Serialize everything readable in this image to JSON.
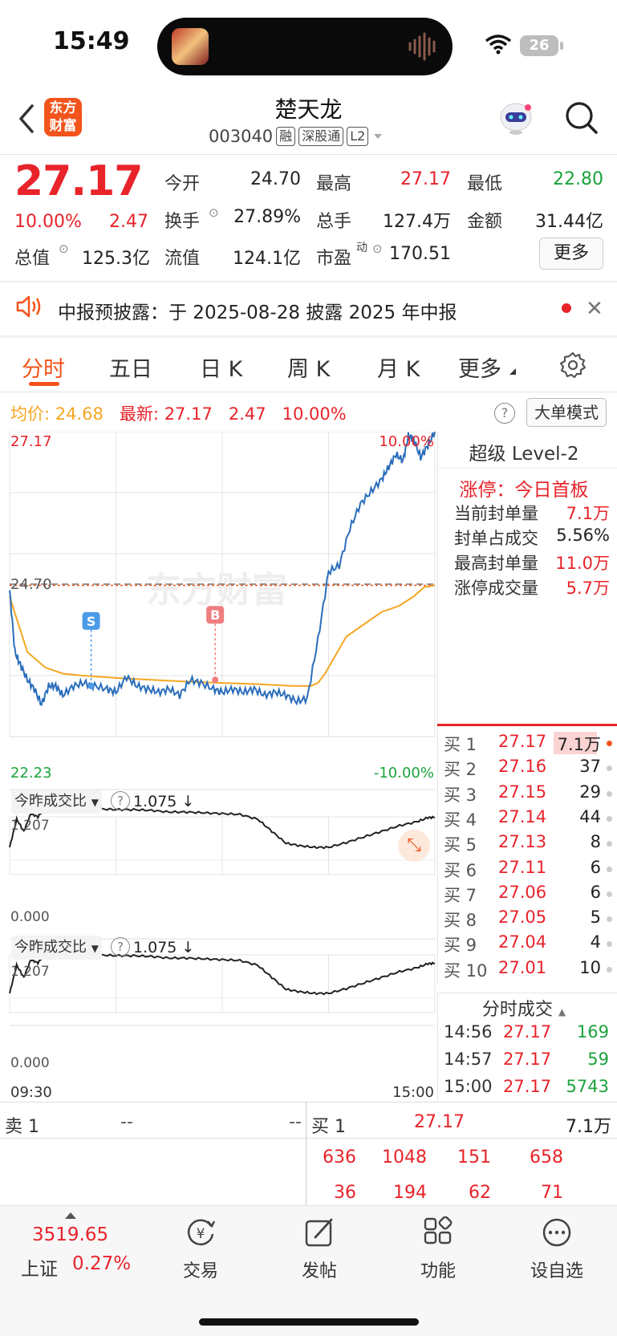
{
  "status_bar": {
    "time": "15:49",
    "battery": "26"
  },
  "header": {
    "brand": "东方财富",
    "name": "楚天龙",
    "code": "003040",
    "tags": [
      "融",
      "深股通",
      "L2"
    ]
  },
  "quote": {
    "price": "27.17",
    "change_pct": "10.00%",
    "change_amt": "2.47",
    "fields": [
      {
        "label": "今开",
        "value": "24.70",
        "color": "#222222"
      },
      {
        "label": "最高",
        "value": "27.17",
        "color": "#e8232a"
      },
      {
        "label": "最低",
        "value": "22.80",
        "color": "#1aa33c"
      },
      {
        "label": "换手",
        "value": "27.89%",
        "color": "#222222"
      },
      {
        "label": "总手",
        "value": "127.4万",
        "color": "#222222"
      },
      {
        "label": "金额",
        "value": "31.44亿",
        "color": "#222222"
      },
      {
        "label": "总值",
        "value": "125.3亿",
        "color": "#222222"
      },
      {
        "label": "流值",
        "value": "124.1亿",
        "color": "#222222"
      },
      {
        "label": "市盈",
        "superscript": "动",
        "value": "170.51",
        "color": "#222222"
      }
    ],
    "more_label": "更多"
  },
  "notice": {
    "text": "中报预披露：于 2025-08-28 披露 2025 年中报"
  },
  "tabs": [
    "分时",
    "五日",
    "日 K",
    "周 K",
    "月 K",
    "更多"
  ],
  "price_line": {
    "avg_label": "均价:",
    "avg_value": "24.68",
    "latest_label": "最新:",
    "latest_value": "27.17",
    "latest_chg": "2.47",
    "latest_pct": "10.00%",
    "help": "?",
    "big_order": "大单模式"
  },
  "chart_data": {
    "type": "line",
    "title": "",
    "y_top_label": "27.17",
    "y_bottom_label": "22.23",
    "pct_top_label": "10.00%",
    "pct_bottom_label": "-10.00%",
    "prev_close_label": "24.70",
    "watermark": "东方财富",
    "x_start": "09:30",
    "x_end": "15:00",
    "ylim": [
      22.23,
      27.17
    ],
    "prev_close": 24.7,
    "price_series": {
      "name": "",
      "x": [
        0,
        3,
        6,
        10,
        14,
        18,
        22,
        26,
        30,
        36,
        42,
        48,
        55,
        60,
        66,
        72,
        78,
        84,
        90,
        96,
        102,
        108,
        115,
        120,
        126,
        132,
        138,
        144,
        150,
        156,
        162,
        168,
        174,
        180,
        186,
        192,
        198,
        204,
        210,
        214,
        218,
        222,
        225,
        228,
        232,
        236,
        240
      ],
      "values": [
        24.6,
        23.6,
        23.4,
        23.15,
        23.0,
        22.75,
        23.05,
        23.05,
        22.9,
        23.05,
        23.1,
        23.05,
        23.0,
        22.95,
        23.2,
        23.05,
        23.0,
        22.95,
        23.0,
        22.9,
        23.15,
        23.1,
        23.0,
        22.95,
        23.0,
        22.95,
        23.0,
        22.9,
        22.95,
        22.9,
        22.8,
        22.85,
        23.8,
        24.9,
        25.0,
        25.6,
        26.0,
        26.2,
        26.4,
        26.6,
        26.8,
        26.7,
        27.1,
        27.05,
        26.75,
        26.95,
        27.17
      ]
    },
    "avg_series": {
      "name": "",
      "x": [
        0,
        10,
        20,
        30,
        40,
        60,
        80,
        100,
        120,
        140,
        160,
        170,
        174,
        178,
        184,
        190,
        200,
        210,
        220,
        228,
        234,
        240
      ],
      "values": [
        24.5,
        23.6,
        23.35,
        23.25,
        23.22,
        23.18,
        23.15,
        23.12,
        23.1,
        23.08,
        23.05,
        23.05,
        23.1,
        23.25,
        23.55,
        23.85,
        24.05,
        24.25,
        24.35,
        24.5,
        24.65,
        24.68
      ]
    },
    "markers": [
      {
        "label": "S",
        "x": 46,
        "value": 23.05
      },
      {
        "label": "B",
        "x": 116,
        "value": 23.15
      }
    ],
    "ratio_chart_label": "今昨成交比",
    "ratio_value": "1.075",
    "ratio_top": "1.207",
    "ratio_bottom": "0.000",
    "ratio_series": {
      "name": "",
      "x": [
        0,
        4,
        8,
        12,
        16,
        20,
        26,
        32,
        40,
        50,
        60,
        70,
        80,
        90,
        100,
        110,
        120,
        130,
        140,
        148,
        156,
        164,
        172,
        180,
        190,
        200,
        210,
        220,
        230,
        236,
        240
      ],
      "values": [
        0.7,
        1.05,
        0.9,
        1.12,
        1.08,
        1.19,
        1.2,
        1.19,
        1.18,
        1.18,
        1.17,
        1.17,
        1.16,
        1.14,
        1.14,
        1.13,
        1.12,
        1.11,
        1.05,
        0.9,
        0.75,
        0.72,
        0.7,
        0.7,
        0.76,
        0.83,
        0.9,
        0.97,
        1.02,
        1.07,
        1.075
      ]
    }
  },
  "level2": {
    "title": "超级 Level-2",
    "limit_label": "涨停：今日首板",
    "rows": [
      {
        "label": "当前封单量",
        "value": "7.1万"
      },
      {
        "label": "封单占成交",
        "value": "5.56%"
      },
      {
        "label": "最高封单量",
        "value": "11.0万"
      },
      {
        "label": "涨停成交量",
        "value": "5.7万"
      }
    ]
  },
  "bids": [
    {
      "label": "买 1",
      "price": "27.17",
      "qty": "7.1万"
    },
    {
      "label": "买 2",
      "price": "27.16",
      "qty": "37"
    },
    {
      "label": "买 3",
      "price": "27.15",
      "qty": "29"
    },
    {
      "label": "买 4",
      "price": "27.14",
      "qty": "44"
    },
    {
      "label": "买 5",
      "price": "27.13",
      "qty": "8"
    },
    {
      "label": "买 6",
      "price": "27.11",
      "qty": "6"
    },
    {
      "label": "买 7",
      "price": "27.06",
      "qty": "6"
    },
    {
      "label": "买 8",
      "price": "27.05",
      "qty": "5"
    },
    {
      "label": "买 9",
      "price": "27.04",
      "qty": "4"
    },
    {
      "label": "买 10",
      "price": "27.01",
      "qty": "10"
    }
  ],
  "trades": {
    "title": "分时成交",
    "rows": [
      {
        "time": "14:56",
        "price": "27.17",
        "vol": "169"
      },
      {
        "time": "14:57",
        "price": "27.17",
        "vol": "59"
      },
      {
        "time": "15:00",
        "price": "27.17",
        "vol": "5743"
      }
    ]
  },
  "order_book": {
    "sell_label": "卖 1",
    "sell_price": "--",
    "sell_qty": "--",
    "buy_label": "买 1",
    "buy_price": "27.17",
    "buy_qty": "7.1万",
    "queue_row1": [
      "636",
      "1048",
      "151",
      "658"
    ],
    "queue_row2": [
      "36",
      "194",
      "62",
      "71"
    ]
  },
  "tabbar": {
    "index_value": "3519.65",
    "index_name": "上证",
    "index_pct": "0.27%",
    "items": [
      "交易",
      "发帖",
      "功能",
      "设自选"
    ]
  },
  "colors": {
    "up": "#e8232a",
    "down": "#1aa33c",
    "accent": "#f2541b",
    "avg": "#f5a623",
    "price_line": "#2a6ebb"
  }
}
